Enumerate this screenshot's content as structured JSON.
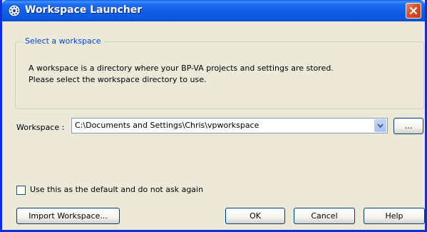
{
  "window": {
    "title": "Workspace Launcher",
    "app_icon": "gear-badge-icon",
    "close_icon": "close-icon"
  },
  "group": {
    "legend": "Select a workspace",
    "description_line1": "A workspace is a directory where your BP-VA projects and settings are stored.",
    "description_line2": "Please select the workspace directory to use."
  },
  "workspace": {
    "label": "Workspace :",
    "value": "C:\\Documents and Settings\\Chris\\vpworkspace",
    "browse_label": "..."
  },
  "default_checkbox": {
    "label": "Use this as the default and do not ask again",
    "checked": false
  },
  "buttons": {
    "import": "Import Workspace...",
    "ok": "OK",
    "cancel": "Cancel",
    "help": "Help"
  },
  "colors": {
    "titlebar": "#0c58dd",
    "legend_text": "#0046d5",
    "window_bg": "#ece9d8",
    "close_button": "#d9502c"
  }
}
